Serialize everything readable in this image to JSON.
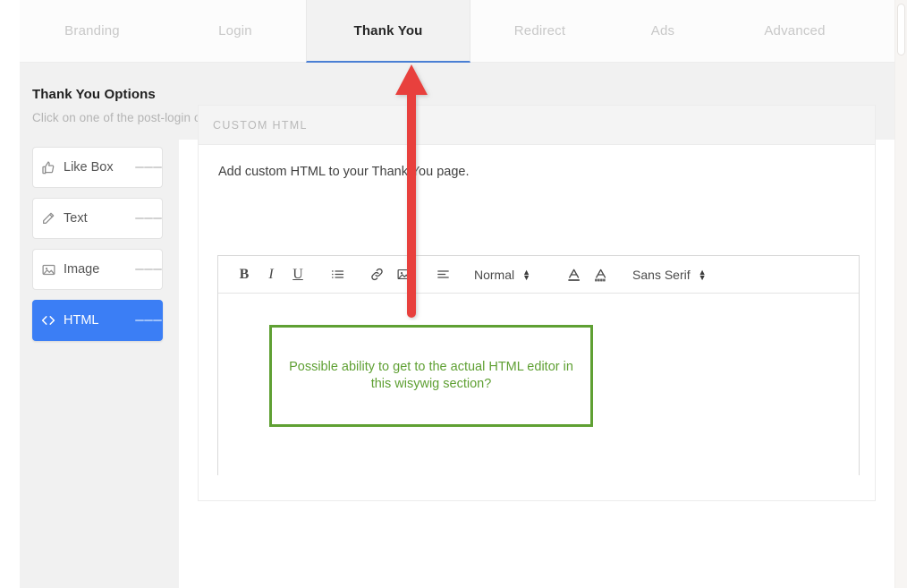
{
  "tabs": [
    {
      "label": "Branding",
      "active": false
    },
    {
      "label": "Login",
      "active": false
    },
    {
      "label": "Thank You",
      "active": true
    },
    {
      "label": "Redirect",
      "active": false
    },
    {
      "label": "Ads",
      "active": false
    },
    {
      "label": "Advanced",
      "active": false
    }
  ],
  "header": {
    "title": "Thank You Options",
    "subtitle": "Click on one of the post-login options to enable them. Drag them around to reorder their position."
  },
  "sidebar": {
    "items": [
      {
        "label": "Like Box",
        "icon": "thumbs-up-icon",
        "active": false
      },
      {
        "label": "Text",
        "icon": "pencil-icon",
        "active": false
      },
      {
        "label": "Image",
        "icon": "picture-icon",
        "active": false
      },
      {
        "label": "HTML",
        "icon": "code-icon",
        "active": true
      }
    ]
  },
  "card": {
    "section_title": "CUSTOM HTML",
    "note": "Add custom HTML to your Thank You page.",
    "editor": {
      "toolbar": {
        "bold": "B",
        "italic": "I",
        "underline": "U",
        "bullet_list": "list-bullet-icon",
        "link": "link-icon",
        "image": "image-icon",
        "align": "align-left-icon",
        "text_color": "text-color-icon",
        "background_color": "highlight-color-icon",
        "format_value": "Normal",
        "font_value": "Sans Serif"
      },
      "content": ""
    }
  },
  "annotation": {
    "text": "Possible ability to get to the actual HTML editor in this wisywig section?",
    "box_color": "#5fa033",
    "arrow_color": "#e8413c"
  },
  "colors": {
    "accent_blue": "#3b7ef5",
    "active_tab_underline": "#4a7fd4",
    "panel_grey": "#f1f1f1",
    "annotation_green": "#5fa033",
    "annotation_red": "#e8413c"
  }
}
